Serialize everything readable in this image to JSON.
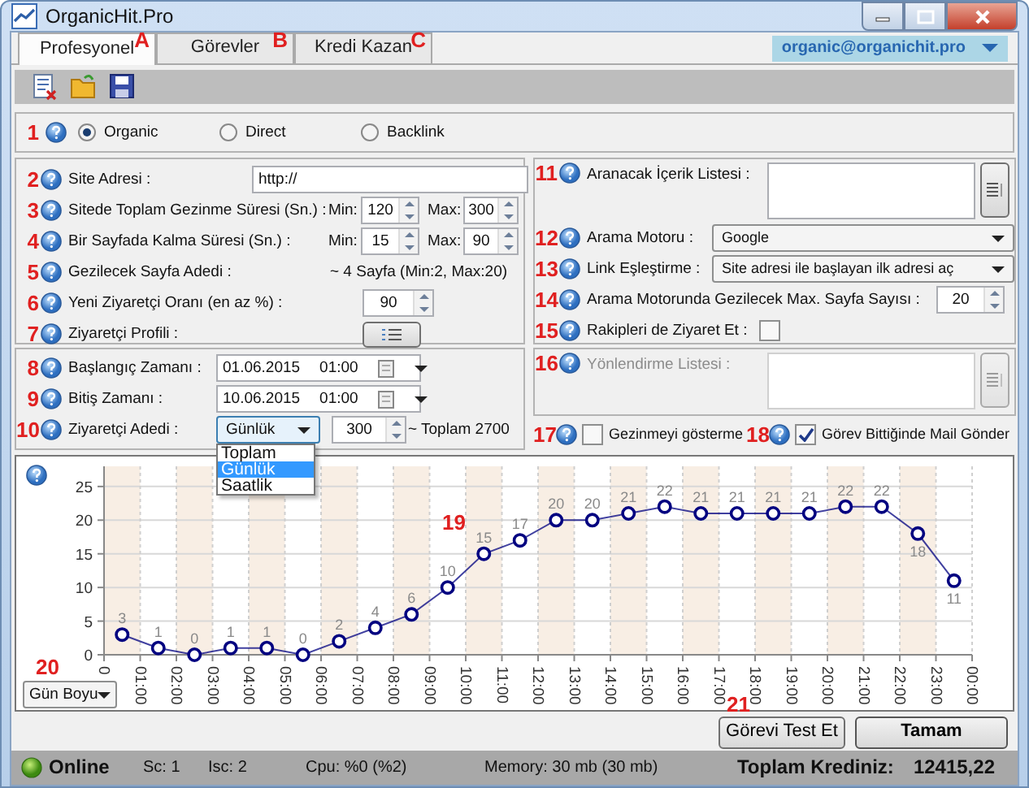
{
  "window": {
    "title": "OrganicHit.Pro"
  },
  "tabs": [
    {
      "label": "Profesyonel",
      "selected": true,
      "callout": "A"
    },
    {
      "label": "Görevler",
      "selected": false,
      "callout": "B"
    },
    {
      "label": "Kredi Kazan",
      "selected": false,
      "callout": "C"
    }
  ],
  "account": {
    "email": "organic@organichit.pro"
  },
  "mode": {
    "callout": "1",
    "options": [
      {
        "label": "Organic",
        "selected": true
      },
      {
        "label": "Direct",
        "selected": false
      },
      {
        "label": "Backlink",
        "selected": false
      }
    ]
  },
  "site_settings": [
    {
      "kind": "text",
      "callout": "2",
      "label": "Site Adresi :",
      "value": "http://"
    },
    {
      "kind": "range",
      "callout": "3",
      "label": "Sitede Toplam Gezinme Süresi (Sn.) :",
      "min_label": "Min:",
      "min": "120",
      "max_label": "Max:",
      "max": "300"
    },
    {
      "kind": "range",
      "callout": "4",
      "label": "Bir Sayfada Kalma Süresi (Sn.) :",
      "min_label": "Min:",
      "min": "15",
      "max_label": "Max:",
      "max": "90"
    },
    {
      "kind": "info",
      "callout": "5",
      "label": "Gezilecek Sayfa Adedi :",
      "value": "~ 4 Sayfa (Min:2, Max:20)"
    },
    {
      "kind": "spin",
      "callout": "6",
      "label": "Yeni Ziyaretçi Oranı (en az %) :",
      "value": "90"
    },
    {
      "kind": "button",
      "callout": "7",
      "label": "Ziyaretçi Profili :"
    }
  ],
  "schedule": [
    {
      "kind": "datetime",
      "callout": "8",
      "label": "Başlangıç Zamanı :",
      "date": "01.06.2015",
      "time": "01:00"
    },
    {
      "kind": "datetime",
      "callout": "9",
      "label": "Bitiş Zamanı :",
      "date": "10.06.2015",
      "time": "01:00"
    },
    {
      "kind": "visitors",
      "callout": "10",
      "label": "Ziyaretçi Adedi :",
      "value": "Günlük",
      "count": "300",
      "total": "~ Toplam 2700",
      "options": [
        {
          "label": "Toplam",
          "selected": false
        },
        {
          "label": "Günlük",
          "selected": true
        },
        {
          "label": "Saatlik",
          "selected": false
        }
      ]
    }
  ],
  "search_settings": [
    {
      "kind": "list",
      "callout": "11",
      "label": "Aranacak İçerik Listesi :"
    },
    {
      "kind": "select",
      "callout": "12",
      "label": "Arama Motoru :",
      "value": "Google"
    },
    {
      "kind": "select",
      "callout": "13",
      "label": "Link Eşleştirme :",
      "value": "Site adresi ile başlayan ilk adresi aç"
    },
    {
      "kind": "spin",
      "callout": "14",
      "label": "Arama Motorunda Gezilecek Max. Sayfa Sayısı :",
      "value": "20"
    },
    {
      "kind": "checkbox",
      "callout": "15",
      "label": "Rakipleri de Ziyaret Et :",
      "checked": false
    }
  ],
  "redirect": {
    "callout": "16",
    "label": "Yönlendirme Listesi :",
    "disabled": true
  },
  "options": [
    {
      "callout": "17",
      "label": "Gezinmeyi gösterme",
      "checked": false
    },
    {
      "callout": "18",
      "label": "Görev Bittiğinde Mail Gönder",
      "checked": true
    }
  ],
  "chart": {
    "callout": "19",
    "range": {
      "callout": "20",
      "value": "Gün Boyu"
    },
    "chart_data": {
      "type": "line",
      "x": [
        0.5,
        1.5,
        2.5,
        3.5,
        4.5,
        5.5,
        6.5,
        7.5,
        8.5,
        9.5,
        10.5,
        11.5,
        12.5,
        13.5,
        14.5,
        15.5,
        16.5,
        17.5,
        18.5,
        19.5,
        20.5,
        21.5,
        22.5,
        23.5
      ],
      "grid": true,
      "series": [
        {
          "color": "#000080",
          "marker": "circle",
          "values": [
            3,
            1,
            0,
            1,
            1,
            0,
            2,
            4,
            6,
            10,
            15,
            17,
            20,
            20,
            21,
            22,
            21,
            21,
            21,
            21,
            22,
            22,
            18,
            11
          ]
        }
      ],
      "xlim": [
        0,
        24
      ],
      "ylim": [
        0,
        28
      ],
      "xticks": [
        {
          "value": 0,
          "label": "0"
        },
        {
          "value": 1,
          "label": "01:00"
        },
        {
          "value": 2,
          "label": "02:00"
        },
        {
          "value": 3,
          "label": "03:00"
        },
        {
          "value": 4,
          "label": "04:00"
        },
        {
          "value": 5,
          "label": "05:00"
        },
        {
          "value": 6,
          "label": "06:00"
        },
        {
          "value": 7,
          "label": "07:00"
        },
        {
          "value": 8,
          "label": "08:00"
        },
        {
          "value": 9,
          "label": "09:00"
        },
        {
          "value": 10,
          "label": "10:00"
        },
        {
          "value": 11,
          "label": "11:00"
        },
        {
          "value": 12,
          "label": "12:00"
        },
        {
          "value": 13,
          "label": "13:00"
        },
        {
          "value": 14,
          "label": "14:00"
        },
        {
          "value": 15,
          "label": "15:00"
        },
        {
          "value": 16,
          "label": "16:00"
        },
        {
          "value": 17,
          "label": "17:00"
        },
        {
          "value": 18,
          "label": "18:00"
        },
        {
          "value": 19,
          "label": "19:00"
        },
        {
          "value": 20,
          "label": "20:00"
        },
        {
          "value": 21,
          "label": "21:00"
        },
        {
          "value": 22,
          "label": "22:00"
        },
        {
          "value": 23,
          "label": "23:00"
        },
        {
          "value": 24,
          "label": "00:00"
        }
      ],
      "yticks": [
        0,
        5,
        10,
        15,
        20,
        25
      ],
      "data_labels": true
    }
  },
  "buttons": [
    {
      "kind": "normal",
      "label": "Görevi Test Et",
      "callout": "21"
    },
    {
      "kind": "default",
      "label": "Tamam"
    }
  ],
  "status_bar": {
    "online": "Online",
    "items": [
      "Sc: 1",
      "Isc: 2",
      "Cpu: %0 (%2)",
      "Memory: 30 mb (30 mb)"
    ],
    "credit_label": "Toplam Krediniz:",
    "credit": "12415,22"
  }
}
